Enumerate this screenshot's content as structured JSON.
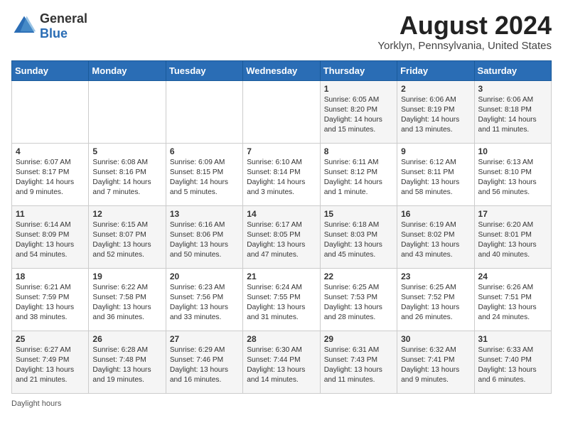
{
  "header": {
    "logo_general": "General",
    "logo_blue": "Blue",
    "month_year": "August 2024",
    "location": "Yorklyn, Pennsylvania, United States"
  },
  "days_of_week": [
    "Sunday",
    "Monday",
    "Tuesday",
    "Wednesday",
    "Thursday",
    "Friday",
    "Saturday"
  ],
  "footer": {
    "daylight_hours": "Daylight hours"
  },
  "weeks": [
    [
      {
        "day": "",
        "info": ""
      },
      {
        "day": "",
        "info": ""
      },
      {
        "day": "",
        "info": ""
      },
      {
        "day": "",
        "info": ""
      },
      {
        "day": "1",
        "info": "Sunrise: 6:05 AM\nSunset: 8:20 PM\nDaylight: 14 hours\nand 15 minutes."
      },
      {
        "day": "2",
        "info": "Sunrise: 6:06 AM\nSunset: 8:19 PM\nDaylight: 14 hours\nand 13 minutes."
      },
      {
        "day": "3",
        "info": "Sunrise: 6:06 AM\nSunset: 8:18 PM\nDaylight: 14 hours\nand 11 minutes."
      }
    ],
    [
      {
        "day": "4",
        "info": "Sunrise: 6:07 AM\nSunset: 8:17 PM\nDaylight: 14 hours\nand 9 minutes."
      },
      {
        "day": "5",
        "info": "Sunrise: 6:08 AM\nSunset: 8:16 PM\nDaylight: 14 hours\nand 7 minutes."
      },
      {
        "day": "6",
        "info": "Sunrise: 6:09 AM\nSunset: 8:15 PM\nDaylight: 14 hours\nand 5 minutes."
      },
      {
        "day": "7",
        "info": "Sunrise: 6:10 AM\nSunset: 8:14 PM\nDaylight: 14 hours\nand 3 minutes."
      },
      {
        "day": "8",
        "info": "Sunrise: 6:11 AM\nSunset: 8:12 PM\nDaylight: 14 hours\nand 1 minute."
      },
      {
        "day": "9",
        "info": "Sunrise: 6:12 AM\nSunset: 8:11 PM\nDaylight: 13 hours\nand 58 minutes."
      },
      {
        "day": "10",
        "info": "Sunrise: 6:13 AM\nSunset: 8:10 PM\nDaylight: 13 hours\nand 56 minutes."
      }
    ],
    [
      {
        "day": "11",
        "info": "Sunrise: 6:14 AM\nSunset: 8:09 PM\nDaylight: 13 hours\nand 54 minutes."
      },
      {
        "day": "12",
        "info": "Sunrise: 6:15 AM\nSunset: 8:07 PM\nDaylight: 13 hours\nand 52 minutes."
      },
      {
        "day": "13",
        "info": "Sunrise: 6:16 AM\nSunset: 8:06 PM\nDaylight: 13 hours\nand 50 minutes."
      },
      {
        "day": "14",
        "info": "Sunrise: 6:17 AM\nSunset: 8:05 PM\nDaylight: 13 hours\nand 47 minutes."
      },
      {
        "day": "15",
        "info": "Sunrise: 6:18 AM\nSunset: 8:03 PM\nDaylight: 13 hours\nand 45 minutes."
      },
      {
        "day": "16",
        "info": "Sunrise: 6:19 AM\nSunset: 8:02 PM\nDaylight: 13 hours\nand 43 minutes."
      },
      {
        "day": "17",
        "info": "Sunrise: 6:20 AM\nSunset: 8:01 PM\nDaylight: 13 hours\nand 40 minutes."
      }
    ],
    [
      {
        "day": "18",
        "info": "Sunrise: 6:21 AM\nSunset: 7:59 PM\nDaylight: 13 hours\nand 38 minutes."
      },
      {
        "day": "19",
        "info": "Sunrise: 6:22 AM\nSunset: 7:58 PM\nDaylight: 13 hours\nand 36 minutes."
      },
      {
        "day": "20",
        "info": "Sunrise: 6:23 AM\nSunset: 7:56 PM\nDaylight: 13 hours\nand 33 minutes."
      },
      {
        "day": "21",
        "info": "Sunrise: 6:24 AM\nSunset: 7:55 PM\nDaylight: 13 hours\nand 31 minutes."
      },
      {
        "day": "22",
        "info": "Sunrise: 6:25 AM\nSunset: 7:53 PM\nDaylight: 13 hours\nand 28 minutes."
      },
      {
        "day": "23",
        "info": "Sunrise: 6:25 AM\nSunset: 7:52 PM\nDaylight: 13 hours\nand 26 minutes."
      },
      {
        "day": "24",
        "info": "Sunrise: 6:26 AM\nSunset: 7:51 PM\nDaylight: 13 hours\nand 24 minutes."
      }
    ],
    [
      {
        "day": "25",
        "info": "Sunrise: 6:27 AM\nSunset: 7:49 PM\nDaylight: 13 hours\nand 21 minutes."
      },
      {
        "day": "26",
        "info": "Sunrise: 6:28 AM\nSunset: 7:48 PM\nDaylight: 13 hours\nand 19 minutes."
      },
      {
        "day": "27",
        "info": "Sunrise: 6:29 AM\nSunset: 7:46 PM\nDaylight: 13 hours\nand 16 minutes."
      },
      {
        "day": "28",
        "info": "Sunrise: 6:30 AM\nSunset: 7:44 PM\nDaylight: 13 hours\nand 14 minutes."
      },
      {
        "day": "29",
        "info": "Sunrise: 6:31 AM\nSunset: 7:43 PM\nDaylight: 13 hours\nand 11 minutes."
      },
      {
        "day": "30",
        "info": "Sunrise: 6:32 AM\nSunset: 7:41 PM\nDaylight: 13 hours\nand 9 minutes."
      },
      {
        "day": "31",
        "info": "Sunrise: 6:33 AM\nSunset: 7:40 PM\nDaylight: 13 hours\nand 6 minutes."
      }
    ]
  ]
}
